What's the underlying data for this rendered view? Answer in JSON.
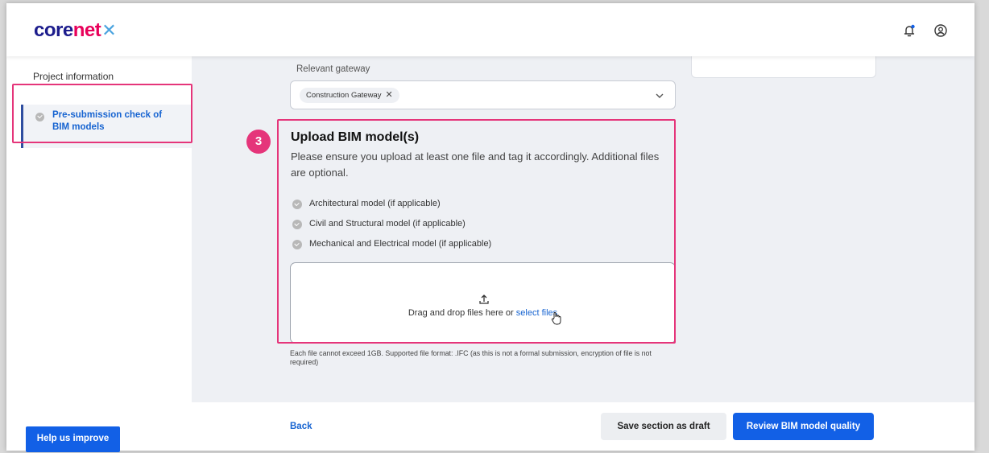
{
  "header": {
    "logo_part1": "core",
    "logo_part2": "net",
    "logo_mark": "✕",
    "icons": [
      "bell-icon",
      "user-profile-icon"
    ]
  },
  "sidebar": {
    "title": "Project information",
    "items": [
      {
        "label": "Pre-submission check of BIM models",
        "status": "completed",
        "icon": "check-circle-icon"
      }
    ],
    "help_button": "Help us improve"
  },
  "form": {
    "gateway_label": "Relevant gateway",
    "gateway_selected": [
      "Construction Gateway"
    ],
    "step_badge": "3",
    "upload_title": "Upload BIM model(s)",
    "upload_description": "Please ensure you upload at least one file and tag it accordingly. Additional files are optional.",
    "requirements": [
      "Architectural model (if applicable)",
      "Civil and Structural model (if applicable)",
      "Mechanical and Electrical model (if applicable)"
    ],
    "dropzone_text": "Drag and drop files here or ",
    "dropzone_link": "select files",
    "note": "Each file cannot exceed 1GB. Supported file format: .IFC (as this is not a formal submission, encryption of file is not required)"
  },
  "footer": {
    "back": "Back",
    "save_draft": "Save section as draft",
    "review": "Review BIM model quality"
  },
  "colors": {
    "primary": "#1260e6",
    "link": "#1764d1",
    "highlight": "#e5357a",
    "brand_navy": "#1c1c8c"
  }
}
